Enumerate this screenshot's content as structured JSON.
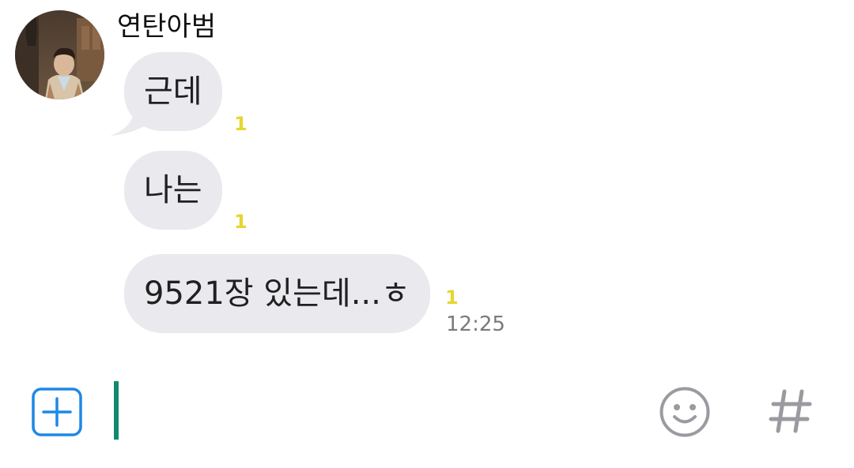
{
  "chat": {
    "sender": {
      "name": "연탄아범",
      "avatar": "profile-photo"
    },
    "messages": [
      {
        "text": "근데",
        "unread": "1"
      },
      {
        "text": "나는",
        "unread": "1"
      },
      {
        "text": "9521장 있는데...ㅎ",
        "unread": "1",
        "time": "12:25"
      }
    ]
  },
  "composer": {
    "input_value": "",
    "plus_icon": "plus-square-icon",
    "emoji_icon": "smiley-icon",
    "hash_icon": "hash-icon"
  },
  "colors": {
    "bubble": "#e9e9ee",
    "unread": "#e6d630",
    "caret": "#0f8a6e",
    "plus_accent": "#1e88e5",
    "icon_gray": "#9a9aa0"
  }
}
